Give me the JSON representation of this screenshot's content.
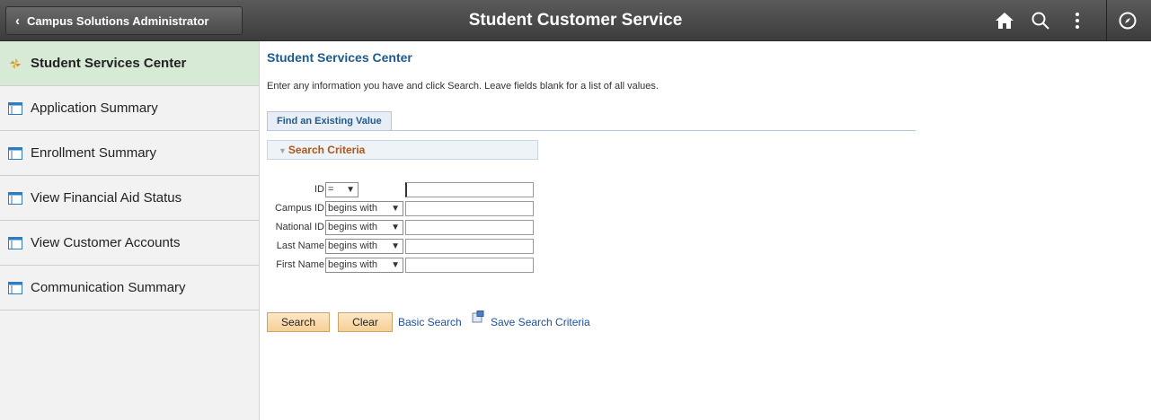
{
  "header": {
    "back_label": "Campus Solutions Administrator",
    "title": "Student Customer Service",
    "icons": [
      "home-icon",
      "search-icon",
      "actions-menu-icon",
      "navbar-icon"
    ]
  },
  "sidebar": {
    "items": [
      {
        "label": "Student Services Center",
        "icon": "pinwheel-icon",
        "active": true
      },
      {
        "label": "Application Summary",
        "icon": "page-icon"
      },
      {
        "label": "Enrollment Summary",
        "icon": "page-icon"
      },
      {
        "label": "View Financial Aid Status",
        "icon": "page-icon"
      },
      {
        "label": "View Customer Accounts",
        "icon": "page-icon"
      },
      {
        "label": "Communication Summary",
        "icon": "page-icon"
      }
    ]
  },
  "main": {
    "title": "Student Services Center",
    "instructions": "Enter any information you have and click Search. Leave fields blank for a list of all values.",
    "tab_label": "Find an Existing Value",
    "criteria_label": "Search Criteria",
    "fields": [
      {
        "label": "ID",
        "operator": "=",
        "value": ""
      },
      {
        "label": "Campus ID",
        "operator": "begins with",
        "value": ""
      },
      {
        "label": "National ID",
        "operator": "begins with",
        "value": ""
      },
      {
        "label": "Last Name",
        "operator": "begins with",
        "value": ""
      },
      {
        "label": "First Name",
        "operator": "begins with",
        "value": ""
      }
    ],
    "buttons": {
      "search": "Search",
      "clear": "Clear"
    },
    "links": {
      "basic_search": "Basic Search",
      "save_criteria": "Save Search Criteria"
    }
  },
  "colors": {
    "accent": "#1f5a8f",
    "active_nav": "#d6ead6",
    "criteria_text": "#b0551a",
    "button": "#f6cf95"
  }
}
